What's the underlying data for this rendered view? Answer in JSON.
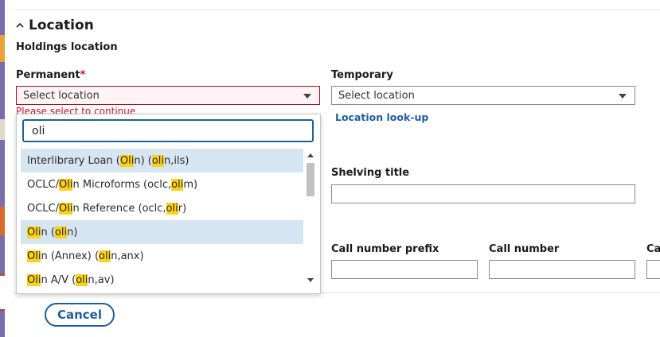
{
  "section": {
    "title": "Location"
  },
  "holdings_location": {
    "label": "Holdings location"
  },
  "permanent": {
    "label": "Permanent",
    "required_mark": "*",
    "value": "Select location",
    "error": "Please select to continue"
  },
  "temporary": {
    "label": "Temporary",
    "value": "Select location",
    "lookup_link": "Location look-up"
  },
  "dropdown": {
    "filter_value": "oli",
    "options": [
      {
        "parts": [
          [
            "Interlibrary Loan (",
            false
          ],
          [
            "Oli",
            true
          ],
          [
            "n) (",
            false
          ],
          [
            "oli",
            true
          ],
          [
            "n,ils)",
            false
          ]
        ],
        "active": true
      },
      {
        "parts": [
          [
            "OCLC/",
            false
          ],
          [
            "Oli",
            true
          ],
          [
            "n Microforms (oclc,",
            false
          ],
          [
            "oli",
            true
          ],
          [
            "m)",
            false
          ]
        ],
        "active": false
      },
      {
        "parts": [
          [
            "OCLC/",
            false
          ],
          [
            "Oli",
            true
          ],
          [
            "n Reference (oclc,",
            false
          ],
          [
            "oli",
            true
          ],
          [
            "r)",
            false
          ]
        ],
        "active": false
      },
      {
        "parts": [
          [
            "Oli",
            true
          ],
          [
            "n (",
            false
          ],
          [
            "oli",
            true
          ],
          [
            "n)",
            false
          ]
        ],
        "active": true
      },
      {
        "parts": [
          [
            "Oli",
            true
          ],
          [
            "n (Annex) (",
            false
          ],
          [
            "oli",
            true
          ],
          [
            "n,anx)",
            false
          ]
        ],
        "active": false
      },
      {
        "parts": [
          [
            "Oli",
            true
          ],
          [
            "n A/V (",
            false
          ],
          [
            "oli",
            true
          ],
          [
            "n,av)",
            false
          ]
        ],
        "active": false
      }
    ]
  },
  "shelving_title": {
    "label": "Shelving title"
  },
  "call_number_prefix": {
    "label": "Call number prefix"
  },
  "call_number": {
    "label": "Call number"
  },
  "call_number_suffix": {
    "label": "Ca"
  },
  "footer": {
    "cancel_label": "Cancel"
  },
  "colors": {
    "link": "#1f5e9c",
    "error": "#c8102e",
    "highlight": "#ffd21a",
    "active_row": "#d6e5f2"
  }
}
